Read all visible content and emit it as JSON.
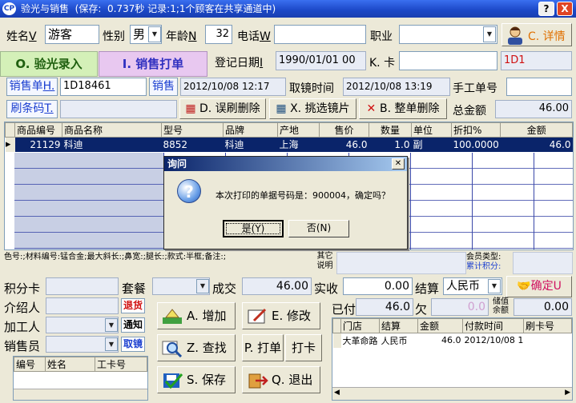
{
  "window": {
    "logo": "CP",
    "title": "验光与销售",
    "status": "(保存:  0.737秒 记录:1;1个顾客在共享通道中)",
    "help_label": "?",
    "close_label": "X"
  },
  "customer": {
    "name_label": "姓名",
    "name_key": "V",
    "name_value": "游客",
    "gender_label": "性别",
    "gender_value": "男",
    "age_label": "年龄",
    "age_key": "N",
    "age_value": "32",
    "phone_label": "电话",
    "phone_key": "W",
    "phone_value": "",
    "job_label": "职业",
    "job_value": "",
    "detail_label": "C. 详情",
    "regdate_label": "登记日期",
    "regdate_key": "I",
    "regdate_value": "1990/01/01 00",
    "card_label": "K. 卡",
    "card_value": "",
    "customer_id": "1D1"
  },
  "tabs": [
    {
      "label": "O. 验光录入"
    },
    {
      "label": "I. 销售打单"
    }
  ],
  "sale": {
    "order_label": "销售单",
    "order_key": "H.",
    "order_value": "1D18461",
    "sale_label": "销售",
    "sale_time": "2012/10/08 12:17",
    "pickup_label": "取镜时间",
    "pickup_time": "2012/10/08 13:19",
    "manual_label": "手工单号",
    "manual_value": "",
    "barcode_label": "刷条码",
    "barcode_key": "T.",
    "barcode_value": "",
    "wrong_delete_label": "D. 误刷删除",
    "pick_lens_label": "X. 挑选镜片",
    "delete_all_label": "B. 整单删除",
    "total_label": "总金额",
    "total_value": "46.00"
  },
  "items_table": {
    "columns": [
      "商品编号",
      "商品名称",
      "型号",
      "品牌",
      "产地",
      "售价",
      "数量",
      "单位",
      "折扣%",
      "金额"
    ],
    "rows": [
      [
        "21129",
        "科迪",
        "8852",
        "科迪",
        "上海",
        "46.0",
        "1.0",
        "副",
        "100.0000",
        "46.0"
      ]
    ]
  },
  "dialog": {
    "title": "询问",
    "message": "本次打印的单据号码是：900004，确定吗？",
    "yes_label": "是(Y)",
    "no_label": "否(N)"
  },
  "info": {
    "desc_text": "色号:;材料编号:锰合金;最大斜长:;鼻宽:;腿长:;款式:半框;备注:;",
    "other_label": "其它说明",
    "member_type_label": "会员类型:",
    "points_label": "累计积分:"
  },
  "payment": {
    "points_card_label": "积分卡",
    "points_card_value": "",
    "package_label": "套餐",
    "package_value": "",
    "deal_label": "成交",
    "deal_value": "46.00",
    "received_label": "实收",
    "received_value": "0.00",
    "settle_label": "结算",
    "settle_currency": "人民币",
    "confirm_label": "确定U",
    "paid_label": "已付",
    "paid_value": "46.0",
    "owed_label": "欠",
    "owed_value": "0.0",
    "stored_label": "储值余额",
    "stored_value": "0.00",
    "referrer_label": "介绍人",
    "referrer_value": "",
    "return_label": "退货",
    "processor_label": "加工人",
    "processor_value": "",
    "notify_label": "通知",
    "seller_label": "销售员",
    "seller_value": "",
    "pickup_btn_label": "取镜"
  },
  "actions": {
    "add": "A. 增加",
    "edit": "E. 修改",
    "find": "Z. 查找",
    "print": "P. 打单",
    "punch": "打卡",
    "save": "S. 保存",
    "exit": "Q. 退出"
  },
  "staff_table": {
    "columns": [
      "编号",
      "姓名",
      "工卡号"
    ]
  },
  "pay_table": {
    "columns": [
      "门店",
      "结算",
      "金额",
      "付款时间",
      "刷卡号"
    ],
    "rows": [
      [
        "大革命路",
        "人民币",
        "46.0",
        "2012/10/08 1",
        ""
      ]
    ]
  },
  "colors": {
    "title_blue": "#1b47c6",
    "selected_row": "#0a246a",
    "tab_active": "#e8c8f0",
    "tab_inactive": "#d4f0b8",
    "link_blue": "#1b3fd0",
    "red": "#d01010"
  }
}
